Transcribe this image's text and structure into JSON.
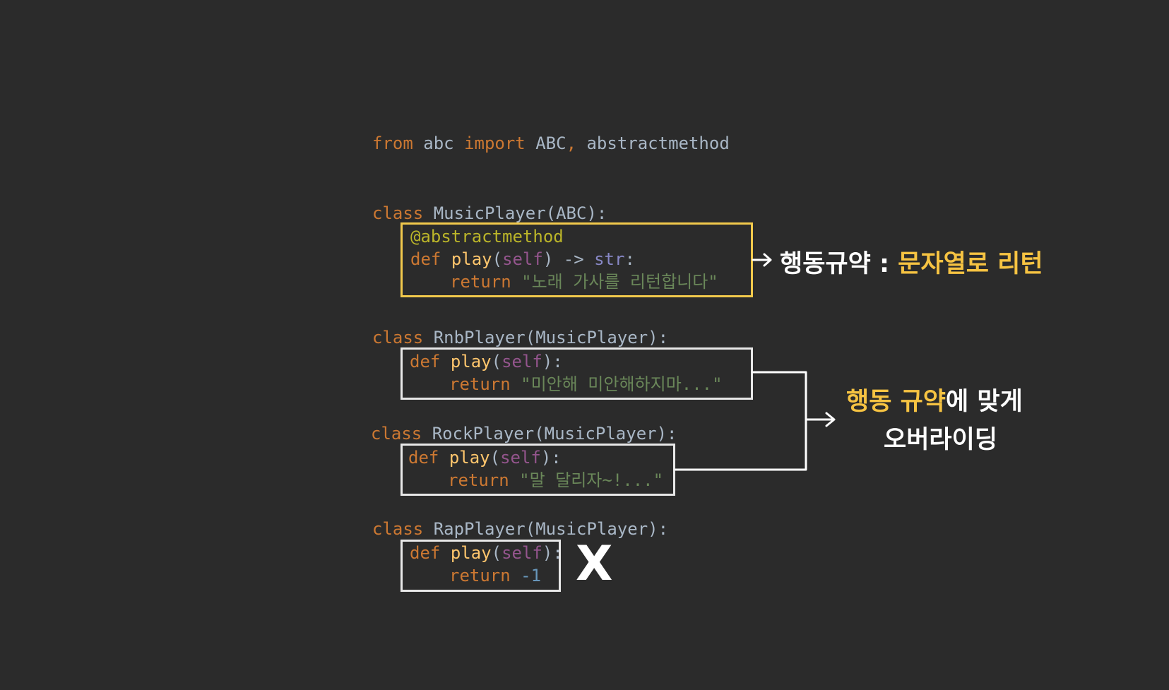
{
  "code": {
    "import_line": {
      "kw_from": "from",
      "module": "abc",
      "kw_import": "import",
      "name1": "ABC",
      "comma": ",",
      "name2": "abstractmethod"
    },
    "music_player": {
      "kw_class": "class",
      "name": "MusicPlayer(ABC):",
      "decorator": "@abstractmethod",
      "kw_def": "def",
      "fn": "play",
      "paren_open": "(",
      "self": "self",
      "sig_rest": ") ->",
      "ret_type": "str",
      "colon": ":",
      "kw_return": "return",
      "ret_value": "\"노래 가사를 리턴합니다\""
    },
    "rnb_player": {
      "kw_class": "class",
      "name": "RnbPlayer(MusicPlayer):",
      "kw_def": "def",
      "fn": "play",
      "paren_open": "(",
      "self": "self",
      "paren_close": "):",
      "kw_return": "return",
      "ret_value": "\"미안해 미안해하지마...\""
    },
    "rock_player": {
      "kw_class": "class",
      "name": "RockPlayer(MusicPlayer):",
      "kw_def": "def",
      "fn": "play",
      "paren_open": "(",
      "self": "self",
      "paren_close": "):",
      "kw_return": "return",
      "ret_value": "\"말 달리자~!...\""
    },
    "rap_player": {
      "kw_class": "class",
      "name": "RapPlayer(MusicPlayer):",
      "kw_def": "def",
      "fn": "play",
      "paren_open": "(",
      "self": "self",
      "paren_close": "):",
      "kw_return": "return",
      "ret_value": "-1"
    }
  },
  "annotations": {
    "contract_label": "행동규약 : ",
    "contract_value": "문자열로 리턴",
    "override_highlight": "행동 규약",
    "override_rest": "에 맞게",
    "override_line2": "오버라이딩",
    "reject_mark": "X"
  },
  "colors": {
    "background": "#2b2b2b",
    "keyword": "#cc7832",
    "function": "#ffc66d",
    "self": "#94558d",
    "string": "#6a8759",
    "decorator": "#bbb529",
    "highlight_box": "#f2c94c",
    "highlight_text": "#f6c342",
    "box": "#e8e8e8"
  }
}
